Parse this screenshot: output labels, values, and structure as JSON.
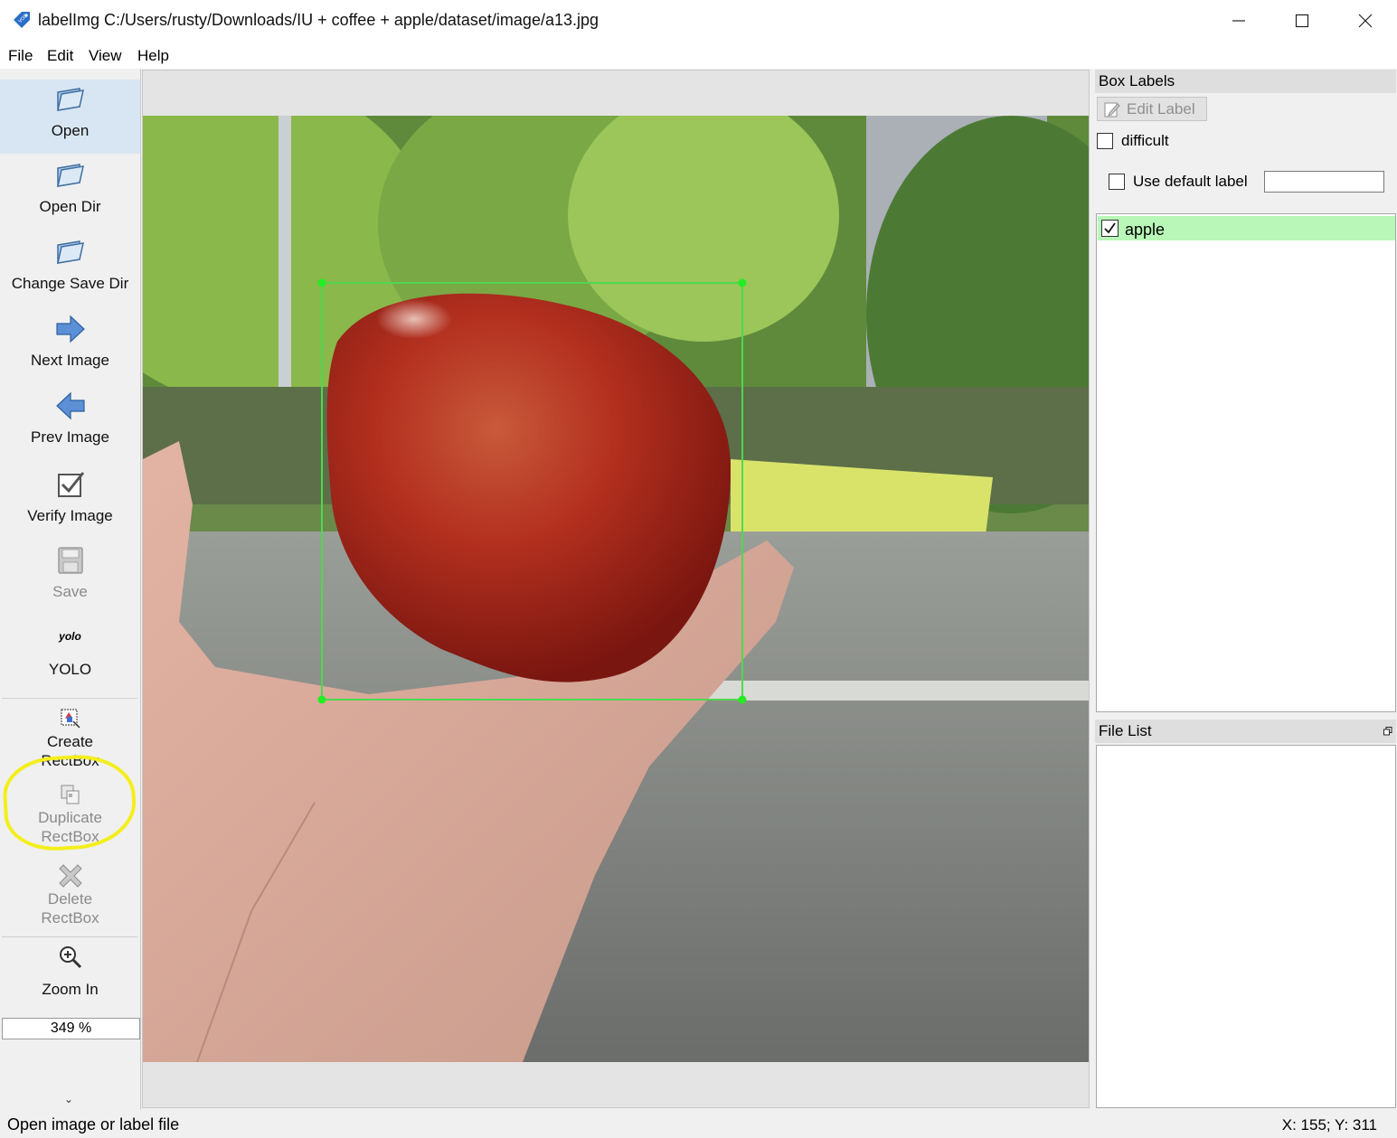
{
  "window": {
    "title": "labelImg C:/Users/rusty/Downloads/IU + coffee + apple/dataset/image/a13.jpg",
    "app_icon": "voc-tag-icon"
  },
  "menu": [
    "File",
    "Edit",
    "View",
    "Help"
  ],
  "toolbar": {
    "open": "Open",
    "open_dir": "Open Dir",
    "change_save_dir": "Change Save Dir",
    "next_image": "Next Image",
    "prev_image": "Prev Image",
    "verify_image": "Verify Image",
    "save": "Save",
    "format_icon_text": "yolo",
    "format": "YOLO",
    "create_rectbox_line1": "Create",
    "create_rectbox_line2": "RectBox",
    "duplicate_rectbox_line1": "Duplicate",
    "duplicate_rectbox_line2": "RectBox",
    "delete_rectbox_line1": "Delete",
    "delete_rectbox_line2": "RectBox",
    "zoom_in": "Zoom In",
    "zoom_value": "349 %"
  },
  "box_labels": {
    "title": "Box Labels",
    "edit_label": "Edit Label",
    "difficult": "difficult",
    "difficult_checked": false,
    "use_default_label": "Use default label",
    "use_default_checked": false,
    "default_label_value": "",
    "items": [
      {
        "label": "apple",
        "checked": true,
        "highlight": "#b8f7b8"
      }
    ]
  },
  "file_list": {
    "title": "File List",
    "items": []
  },
  "status": {
    "message": "Open image or label file",
    "coords": "X: 155; Y: 311"
  },
  "colors": {
    "bbox": "#22dd22",
    "annotation_circle": "#f4ee1c",
    "label_highlight": "#b8f7b8"
  }
}
